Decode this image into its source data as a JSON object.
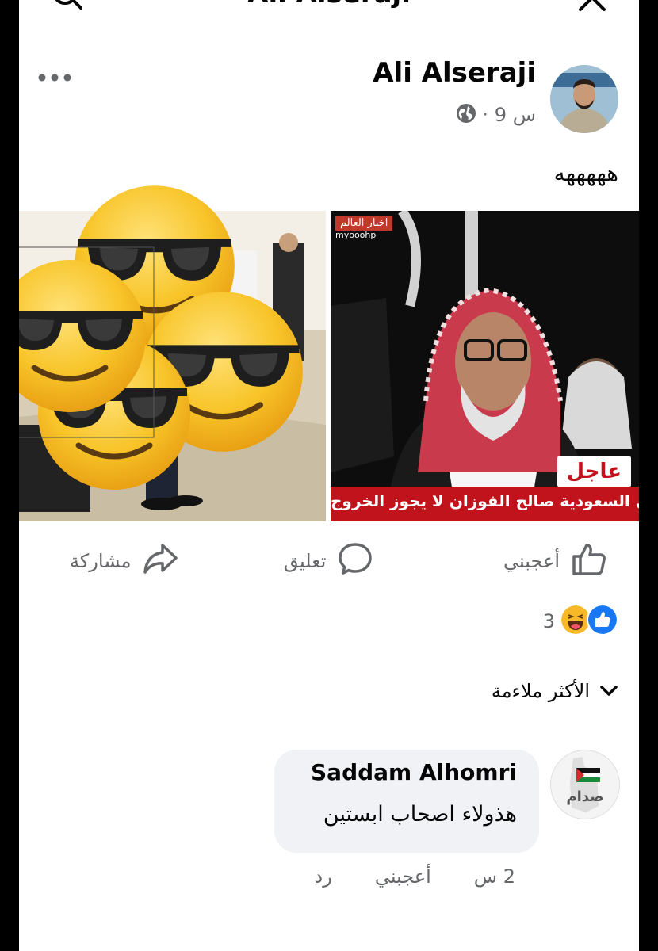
{
  "header": {
    "title": "Ali Alseraji",
    "icons": {
      "search": "search-icon",
      "close": "close-icon"
    }
  },
  "post": {
    "author": "Ali Alseraji",
    "time": "9 س",
    "separator": "·",
    "privacy_icon": "globe-icon",
    "text": "هههههه",
    "more_icon": "more-options-icon",
    "images": [
      {
        "name": "emoji-covered-photo"
      },
      {
        "name": "news-screenshot",
        "logo": "اخبار العالم",
        "handle": "myooohp",
        "breaking": "عاجل",
        "ticker": "مفتي السعودية صالح الفوزان لا يجوز الخروج"
      }
    ]
  },
  "actions": {
    "like": "أعجبني",
    "comment": "تعليق",
    "share": "مشاركة"
  },
  "reactions": {
    "count": "3",
    "types": [
      "like",
      "haha"
    ]
  },
  "sort": {
    "label": "الأكثر ملاءمة"
  },
  "comment": {
    "author": "Saddam Alhomri",
    "text": "هذولاء اصحاب ابستين",
    "time": "2 س",
    "like": "أعجبني",
    "reply": "رد",
    "avatar_label": "صدام"
  },
  "colors": {
    "brand_blue": "#1877f2",
    "muted": "#65676b",
    "bubble": "#f0f2f5",
    "breaking_red": "#c0131b"
  }
}
